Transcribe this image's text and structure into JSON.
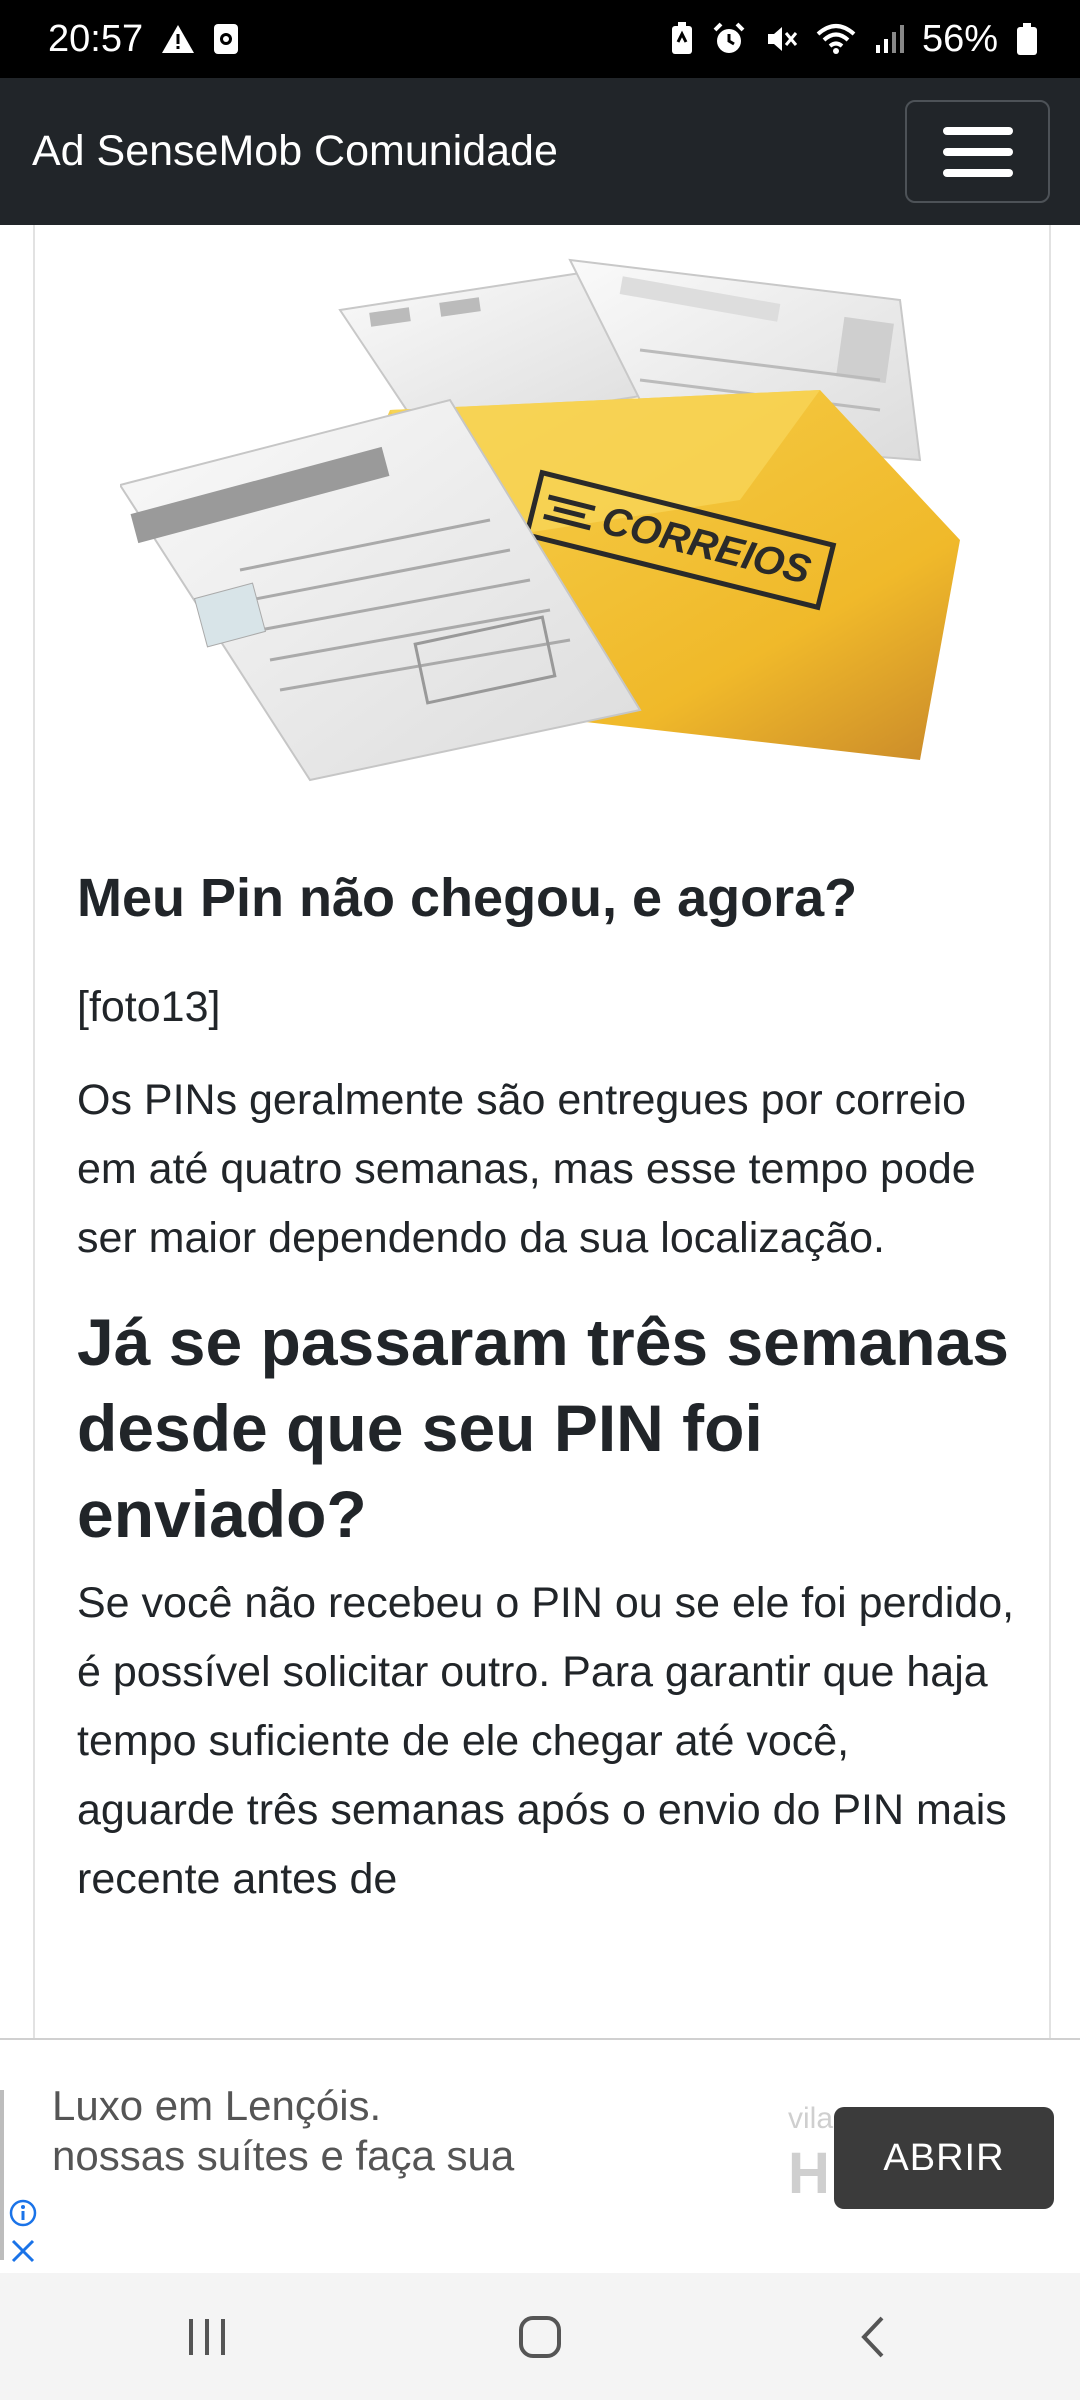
{
  "status_bar": {
    "time": "20:57",
    "battery": "56%",
    "left_icons": [
      "warning-icon",
      "notification-icon"
    ],
    "right_icons": [
      "battery-saver-icon",
      "alarm-icon",
      "mute-icon",
      "wifi-icon",
      "signal-icon",
      "battery-icon"
    ]
  },
  "navbar": {
    "brand": "Ad SenseMob Comunidade",
    "menu_icon": "hamburger-menu-icon"
  },
  "hero": {
    "envelope_text": "CORREIOS",
    "colors": {
      "envelope": "#f2c23c",
      "paper": "#f4f4f0"
    }
  },
  "article": {
    "subtitle": "Meu Pin não chegou, e agora?",
    "placeholder": "[foto13]",
    "paragraph1": "Os PINs geralmente são entregues por correio em até quatro semanas, mas esse tempo pode ser maior dependendo da sua localização.",
    "heading": "Já se passaram três semanas desde que seu PIN foi enviado?",
    "paragraph2": "Se você não recebeu o PIN ou se ele foi perdido, é possível solicitar outro. Para garantir que haja tempo suficiente de ele chegar até você, aguarde três semanas após o envio do PIN mais recente antes de"
  },
  "ad": {
    "line1": "Luxo em Lençóis.",
    "line2": "nossas suítes e faça sua",
    "ghost_small": "vila",
    "ghost_big": "H",
    "button": "ABRIR"
  },
  "system_nav": {
    "icons": [
      "recents-icon",
      "home-icon",
      "back-icon"
    ]
  },
  "colors": {
    "navbar": "#212529",
    "ad_button": "#3b3b3b",
    "ad_icon": "#1a73e8"
  }
}
